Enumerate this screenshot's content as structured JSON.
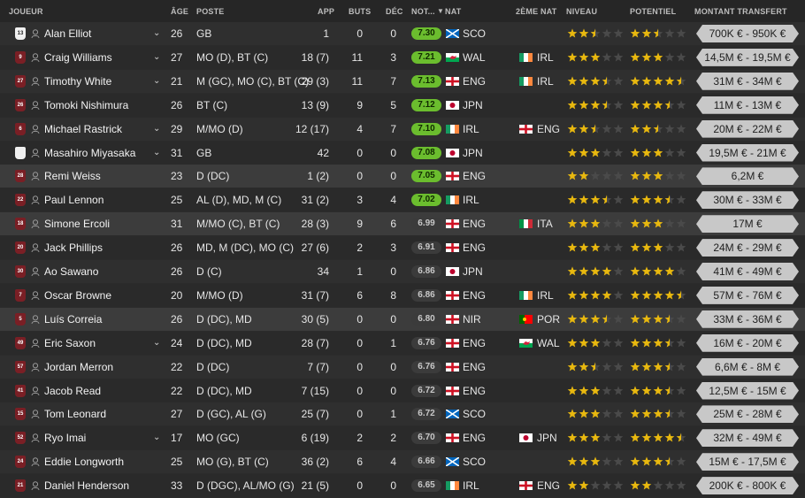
{
  "headers": {
    "player": "JOUEUR",
    "age": "ÂGE",
    "position": "POSTE",
    "app": "APP",
    "goals": "BUTS",
    "decisive": "DÉC",
    "rating": "NOT...",
    "nat": "NAT",
    "second_nat": "2ÈME NAT",
    "level": "NIVEAU",
    "potential": "POTENTIEL",
    "transfer_value": "MONTANT TRANSFERT"
  },
  "colors": {
    "rating_good": "#6bbd2e",
    "rating_average": "#3b3b3b",
    "star_gold": "#e8b80f",
    "fee_pill": "#c8c8c8"
  },
  "rows": [
    {
      "kit": "13",
      "name": "Alan Elliot",
      "expand": true,
      "age": "26",
      "pos": "GB",
      "app": "1",
      "goals": "0",
      "dec": "0",
      "rating": "7.30",
      "good": true,
      "nat_flag": "sco",
      "nat": "SCO",
      "nat2_flag": "",
      "nat2": "",
      "level": 2.5,
      "potential": 2.5,
      "fee": "700K € - 950K €",
      "kit_style": "gk"
    },
    {
      "kit": "9",
      "name": "Craig Williams",
      "expand": true,
      "age": "27",
      "pos": "MO (D), BT (C)",
      "app": "18 (7)",
      "goals": "11",
      "dec": "3",
      "rating": "7.21",
      "good": true,
      "nat_flag": "wal",
      "nat": "WAL",
      "nat2_flag": "irl",
      "nat2": "IRL",
      "level": 3,
      "potential": 3,
      "fee": "14,5M € - 19,5M €",
      "kit_style": "red"
    },
    {
      "kit": "27",
      "name": "Timothy White",
      "expand": true,
      "age": "21",
      "pos": "M (GC), MO (C), BT (C)",
      "app": "29 (3)",
      "goals": "11",
      "dec": "7",
      "rating": "7.13",
      "good": true,
      "nat_flag": "eng",
      "nat": "ENG",
      "nat2_flag": "irl",
      "nat2": "IRL",
      "level": 3.5,
      "potential": 4.5,
      "fee": "31M € - 34M €",
      "kit_style": "red"
    },
    {
      "kit": "26",
      "name": "Tomoki Nishimura",
      "expand": false,
      "age": "26",
      "pos": "BT (C)",
      "app": "13 (9)",
      "goals": "9",
      "dec": "5",
      "rating": "7.12",
      "good": true,
      "nat_flag": "jpn",
      "nat": "JPN",
      "nat2_flag": "",
      "nat2": "",
      "level": 3.5,
      "potential": 3.5,
      "fee": "11M € - 13M €",
      "kit_style": "red"
    },
    {
      "kit": "6",
      "name": "Michael Rastrick",
      "expand": true,
      "age": "29",
      "pos": "M/MO (D)",
      "app": "12 (17)",
      "goals": "4",
      "dec": "7",
      "rating": "7.10",
      "good": true,
      "nat_flag": "irl",
      "nat": "IRL",
      "nat2_flag": "eng",
      "nat2": "ENG",
      "level": 2.5,
      "potential": 2.5,
      "fee": "20M € - 22M €",
      "kit_style": "red"
    },
    {
      "kit": "",
      "name": "Masahiro Miyasaka",
      "expand": true,
      "age": "31",
      "pos": "GB",
      "app": "42",
      "goals": "0",
      "dec": "0",
      "rating": "7.08",
      "good": true,
      "nat_flag": "jpn",
      "nat": "JPN",
      "nat2_flag": "",
      "nat2": "",
      "level": 3,
      "potential": 3,
      "fee": "19,5M € - 21M €",
      "kit_style": "gk"
    },
    {
      "kit": "28",
      "name": "Remi Weiss",
      "expand": false,
      "age": "23",
      "pos": "D (DC)",
      "app": "1 (2)",
      "goals": "0",
      "dec": "0",
      "rating": "7.05",
      "good": true,
      "nat_flag": "eng",
      "nat": "ENG",
      "nat2_flag": "",
      "nat2": "",
      "level": 2,
      "potential": 3,
      "fee": "6,2M €",
      "kit_style": "red",
      "hl": true
    },
    {
      "kit": "22",
      "name": "Paul Lennon",
      "expand": false,
      "age": "25",
      "pos": "AL (D), MD, M (C)",
      "app": "31 (2)",
      "goals": "3",
      "dec": "4",
      "rating": "7.02",
      "good": true,
      "nat_flag": "irl",
      "nat": "IRL",
      "nat2_flag": "",
      "nat2": "",
      "level": 3.5,
      "potential": 3.5,
      "fee": "30M € - 33M €",
      "kit_style": "red"
    },
    {
      "kit": "18",
      "name": "Simone Ercoli",
      "expand": false,
      "age": "31",
      "pos": "M/MO (C), BT (C)",
      "app": "28 (3)",
      "goals": "9",
      "dec": "6",
      "rating": "6.99",
      "good": false,
      "nat_flag": "eng",
      "nat": "ENG",
      "nat2_flag": "ita",
      "nat2": "ITA",
      "level": 3,
      "potential": 3,
      "fee": "17M €",
      "kit_style": "red",
      "hl": true
    },
    {
      "kit": "20",
      "name": "Jack Phillips",
      "expand": false,
      "age": "26",
      "pos": "MD, M (DC), MO (C)",
      "app": "27 (6)",
      "goals": "2",
      "dec": "3",
      "rating": "6.91",
      "good": false,
      "nat_flag": "eng",
      "nat": "ENG",
      "nat2_flag": "",
      "nat2": "",
      "level": 3,
      "potential": 3,
      "fee": "24M € - 29M €",
      "kit_style": "red"
    },
    {
      "kit": "30",
      "name": "Ao Sawano",
      "expand": false,
      "age": "26",
      "pos": "D (C)",
      "app": "34",
      "goals": "1",
      "dec": "0",
      "rating": "6.86",
      "good": false,
      "nat_flag": "jpn",
      "nat": "JPN",
      "nat2_flag": "",
      "nat2": "",
      "level": 4,
      "potential": 4,
      "fee": "41M € - 49M €",
      "kit_style": "red"
    },
    {
      "kit": "7",
      "name": "Oscar Browne",
      "expand": false,
      "age": "20",
      "pos": "M/MO (D)",
      "app": "31 (7)",
      "goals": "6",
      "dec": "8",
      "rating": "6.86",
      "good": false,
      "nat_flag": "eng",
      "nat": "ENG",
      "nat2_flag": "irl",
      "nat2": "IRL",
      "level": 4,
      "potential": 4.5,
      "fee": "57M € - 76M €",
      "kit_style": "red"
    },
    {
      "kit": "5",
      "name": "Luís Correia",
      "expand": false,
      "age": "26",
      "pos": "D (DC), MD",
      "app": "30 (5)",
      "goals": "0",
      "dec": "0",
      "rating": "6.80",
      "good": false,
      "nat_flag": "nir",
      "nat": "NIR",
      "nat2_flag": "por",
      "nat2": "POR",
      "level": 3.5,
      "potential": 3.5,
      "fee": "33M € - 36M €",
      "kit_style": "red",
      "hl": true
    },
    {
      "kit": "49",
      "name": "Eric Saxon",
      "expand": true,
      "age": "24",
      "pos": "D (DC), MD",
      "app": "28 (7)",
      "goals": "0",
      "dec": "1",
      "rating": "6.76",
      "good": false,
      "nat_flag": "eng",
      "nat": "ENG",
      "nat2_flag": "wal",
      "nat2": "WAL",
      "level": 3,
      "potential": 3.5,
      "fee": "16M € - 20M €",
      "kit_style": "red"
    },
    {
      "kit": "57",
      "name": "Jordan Merron",
      "expand": false,
      "age": "22",
      "pos": "D (DC)",
      "app": "7 (7)",
      "goals": "0",
      "dec": "0",
      "rating": "6.76",
      "good": false,
      "nat_flag": "eng",
      "nat": "ENG",
      "nat2_flag": "",
      "nat2": "",
      "level": 2.5,
      "potential": 3.5,
      "fee": "6,6M € - 8M €",
      "kit_style": "red"
    },
    {
      "kit": "41",
      "name": "Jacob Read",
      "expand": false,
      "age": "22",
      "pos": "D (DC), MD",
      "app": "7 (15)",
      "goals": "0",
      "dec": "0",
      "rating": "6.72",
      "good": false,
      "nat_flag": "eng",
      "nat": "ENG",
      "nat2_flag": "",
      "nat2": "",
      "level": 3,
      "potential": 3.5,
      "fee": "12,5M € - 15M €",
      "kit_style": "red"
    },
    {
      "kit": "15",
      "name": "Tom Leonard",
      "expand": false,
      "age": "27",
      "pos": "D (GC), AL (G)",
      "app": "25 (7)",
      "goals": "0",
      "dec": "1",
      "rating": "6.72",
      "good": false,
      "nat_flag": "sco",
      "nat": "SCO",
      "nat2_flag": "",
      "nat2": "",
      "level": 3,
      "potential": 3.5,
      "fee": "25M € - 28M €",
      "kit_style": "red"
    },
    {
      "kit": "52",
      "name": "Ryo Imai",
      "expand": true,
      "age": "17",
      "pos": "MO (GC)",
      "app": "6 (19)",
      "goals": "2",
      "dec": "2",
      "rating": "6.70",
      "good": false,
      "nat_flag": "eng",
      "nat": "ENG",
      "nat2_flag": "jpn",
      "nat2": "JPN",
      "level": 3,
      "potential": 4.5,
      "fee": "32M € - 49M €",
      "kit_style": "red"
    },
    {
      "kit": "24",
      "name": "Eddie Longworth",
      "expand": false,
      "age": "25",
      "pos": "MO (G), BT (C)",
      "app": "36 (2)",
      "goals": "6",
      "dec": "4",
      "rating": "6.66",
      "good": false,
      "nat_flag": "sco",
      "nat": "SCO",
      "nat2_flag": "",
      "nat2": "",
      "level": 3,
      "potential": 3.5,
      "fee": "15M € - 17,5M €",
      "kit_style": "red"
    },
    {
      "kit": "21",
      "name": "Daniel Henderson",
      "expand": false,
      "age": "33",
      "pos": "D (DGC), AL/MO (G)",
      "app": "21 (5)",
      "goals": "0",
      "dec": "0",
      "rating": "6.65",
      "good": false,
      "nat_flag": "irl",
      "nat": "IRL",
      "nat2_flag": "eng",
      "nat2": "ENG",
      "level": 2,
      "potential": 2,
      "fee": "200K € - 800K €",
      "kit_style": "red"
    }
  ]
}
